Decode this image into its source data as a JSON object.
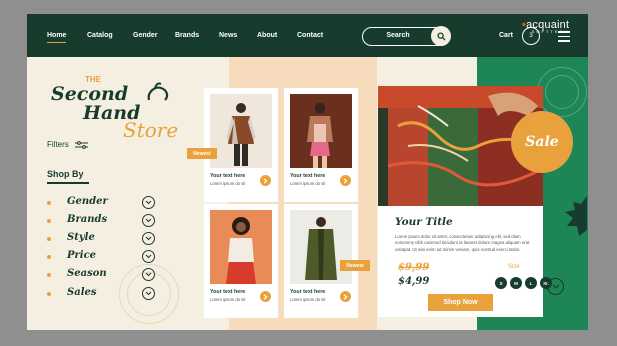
{
  "nav": {
    "links": [
      "Home",
      "Catalog",
      "Gender",
      "Brands",
      "News",
      "About",
      "Contact"
    ],
    "search_label": "Search",
    "cart_label": "Cart",
    "cart_count": "3"
  },
  "brand_logo": {
    "text": "acquaint",
    "sub": "SOFTTECH"
  },
  "logo": {
    "the": "THE",
    "line1": "Second",
    "line2": "Hand",
    "line3": "Store"
  },
  "sidebar": {
    "filters_label": "Filters",
    "shop_by_label": "Shop By",
    "categories": [
      "Gender",
      "Brands",
      "Style",
      "Price",
      "Season",
      "Sales"
    ]
  },
  "products": [
    {
      "title": "Your text here",
      "subtitle": "Lorem ipsum do sit"
    },
    {
      "title": "Your text here",
      "subtitle": "Lorem ipsum do sit"
    },
    {
      "title": "Your text here",
      "subtitle": "Lorem ipsum do sit"
    },
    {
      "title": "Your text here",
      "subtitle": "Lorem ipsum do sit"
    }
  ],
  "badges": {
    "newest_1": "Newest",
    "newest_2": "Newest"
  },
  "feature": {
    "sale_label": "Sale",
    "title": "Your Title",
    "description": "Lorem ipsum dolor sit amet, consectetuer adipiscing elit, sed diam nonummy nibh euismod tincidunt ut laoreet dolore magna aliquam erat volutpat. Ut wisi enim ad minim veniam, quis nostrud exerci tation.",
    "old_price": "$9,99",
    "new_price": "$4,99",
    "size_label": "Size",
    "sizes": [
      "S",
      "M",
      "L",
      "XL"
    ],
    "cta_label": "Shop Now"
  },
  "colors": {
    "dark_green": "#173c2d",
    "accent": "#e9a23b",
    "green": "#1e8656",
    "cream": "#f5efe2",
    "peach": "#f6dcbd"
  }
}
